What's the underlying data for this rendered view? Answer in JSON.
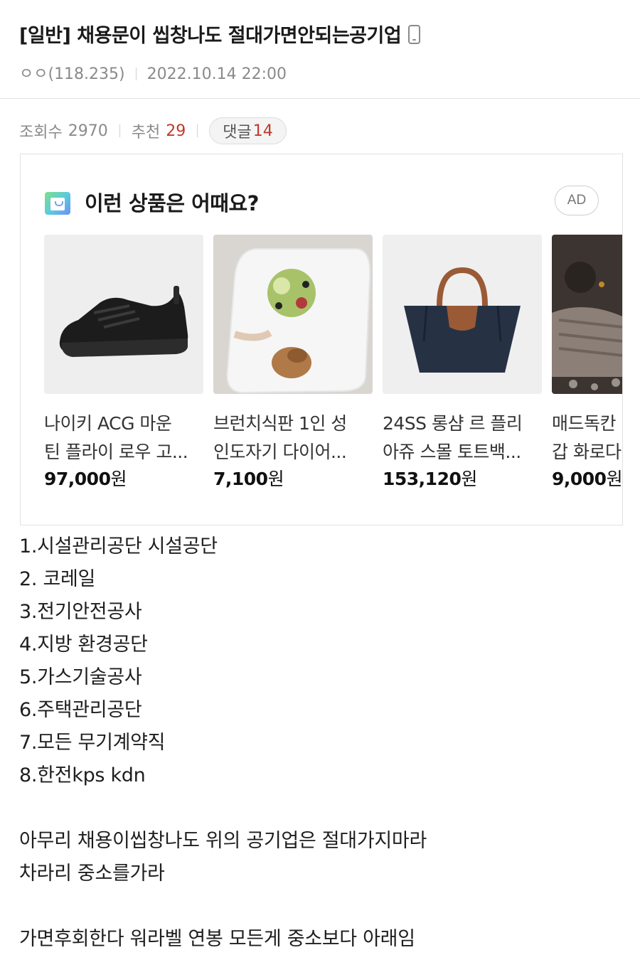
{
  "post": {
    "title": "[일반] 채용문이 씹창나도 절대가면안되는공기업",
    "author": "ㅇㅇ(118.235)",
    "date": "2022.10.14 22:00",
    "views_label": "조회수",
    "views": "2970",
    "recommend_label": "추천",
    "recommend": "29",
    "comments_label": "댓글",
    "comments": "14"
  },
  "ad": {
    "title": "이런 상품은 어때요?",
    "badge": "AD",
    "products": [
      {
        "name_line1": "나이키 ACG 마운",
        "name_line2": "틴 플라이 로우 고...",
        "price": "97,000",
        "unit": "원",
        "image": "black-sneaker"
      },
      {
        "name_line1": "브런치식판 1인 성",
        "name_line2": "인도자기 다이어...",
        "price": "7,100",
        "unit": "원",
        "image": "salad-plate"
      },
      {
        "name_line1": "24SS 롱샴 르 플리",
        "name_line2": "아쥬 스몰 토트백...",
        "price": "153,120",
        "unit": "원",
        "image": "navy-tote-bag"
      },
      {
        "name_line1": "매드독칸",
        "name_line2": "갑 화로다",
        "price": "9,000",
        "unit": "원",
        "image": "knit-gloves"
      }
    ]
  },
  "body": {
    "list": [
      "1.시설관리공단 시설공단",
      "2. 코레일",
      "3.전기안전공사",
      "4.지방 환경공단",
      "5.가스기술공사",
      "6.주택관리공단",
      "7.모든 무기계약직",
      "8.한전kps kdn"
    ],
    "paragraph1_line1": "아무리 채용이씹창나도 위의 공기업은 절대가지마라",
    "paragraph1_line2": "차라리 중소를가라",
    "paragraph2": "가면후회한다 워라벨 연봉 모든게 중소보다 아래임"
  }
}
